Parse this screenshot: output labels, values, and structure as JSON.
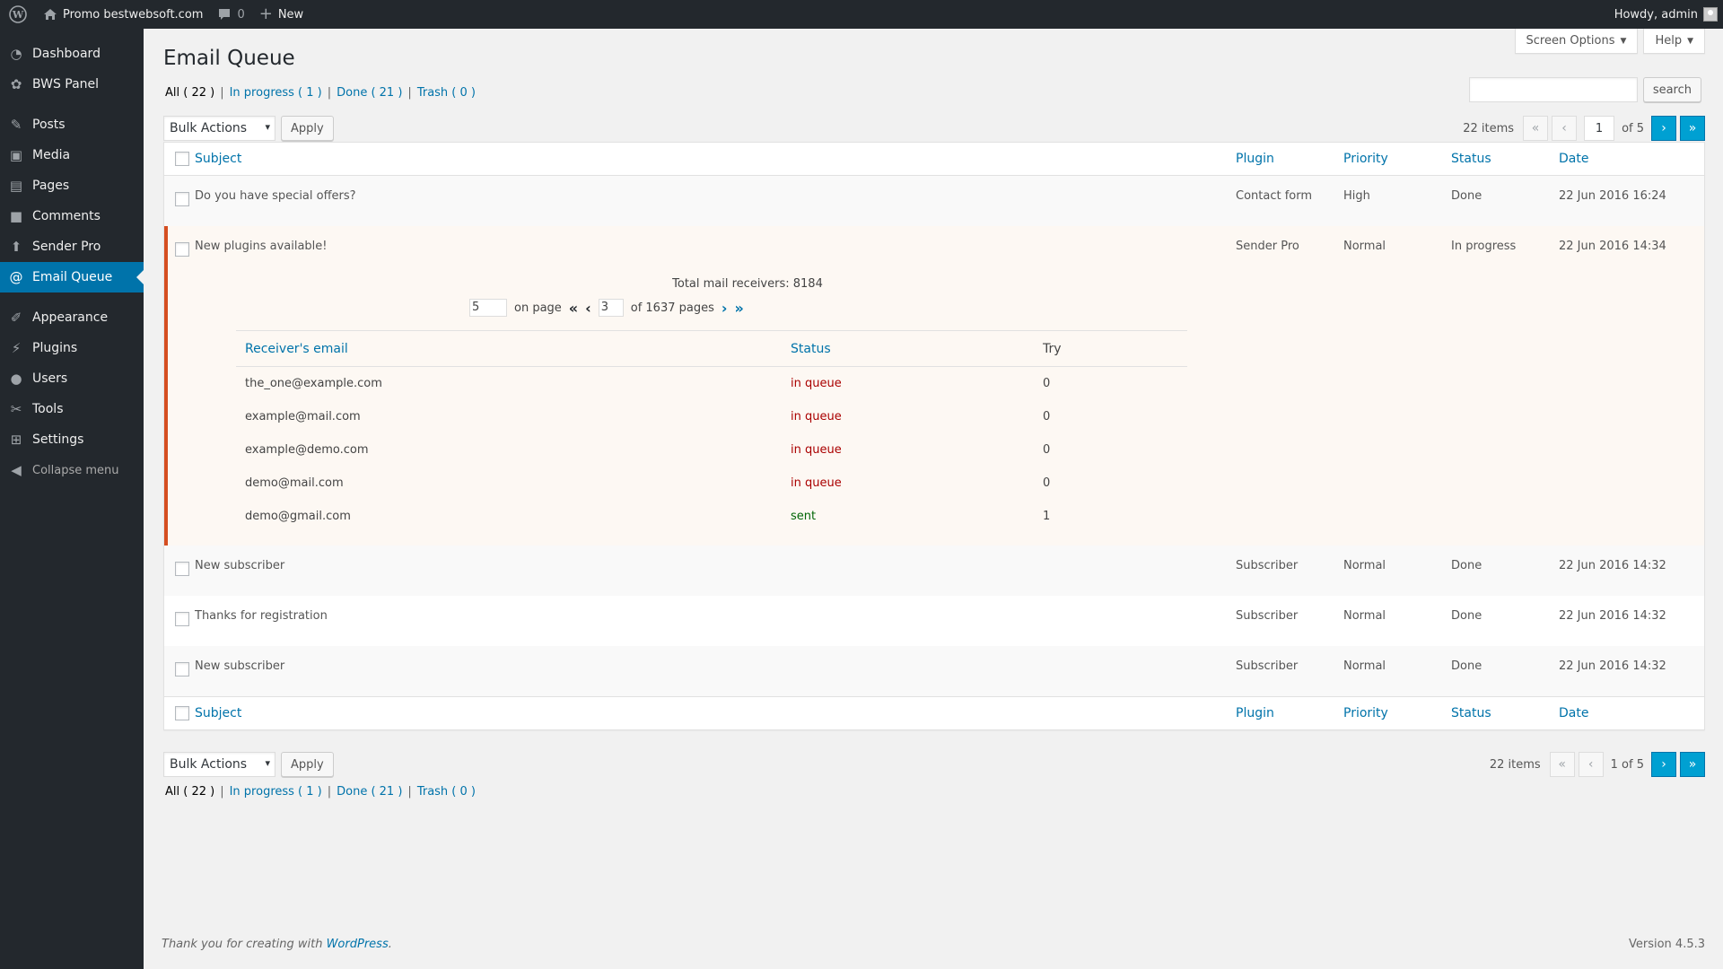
{
  "adminbar": {
    "site_name": "Promo bestwebsoft.com",
    "comments_count": "0",
    "new_label": "New",
    "howdy": "Howdy, admin"
  },
  "sidebar": {
    "items": [
      {
        "label": "Dashboard",
        "icon": "dashboard-icon"
      },
      {
        "label": "BWS Panel",
        "icon": "bws-panel-icon"
      },
      {
        "label": "Posts",
        "icon": "pin-icon"
      },
      {
        "label": "Media",
        "icon": "media-icon"
      },
      {
        "label": "Pages",
        "icon": "pages-icon"
      },
      {
        "label": "Comments",
        "icon": "comment-icon"
      },
      {
        "label": "Sender Pro",
        "icon": "sender-icon"
      },
      {
        "label": "Email Queue",
        "icon": "at-icon"
      },
      {
        "label": "Appearance",
        "icon": "brush-icon"
      },
      {
        "label": "Plugins",
        "icon": "plug-icon"
      },
      {
        "label": "Users",
        "icon": "user-icon"
      },
      {
        "label": "Tools",
        "icon": "wrench-icon"
      },
      {
        "label": "Settings",
        "icon": "settings-icon"
      }
    ],
    "collapse_label": "Collapse menu"
  },
  "screen_options_label": "Screen Options",
  "help_label": "Help",
  "page_title": "Email Queue",
  "filters": {
    "all": "All ( 22 )",
    "in_progress": "In progress ( 1 )",
    "done": "Done ( 21 )",
    "trash": "Trash ( 0 )",
    "sep": "|"
  },
  "search": {
    "button": "search",
    "value": ""
  },
  "bulk": {
    "selected": "Bulk Actions",
    "apply": "Apply"
  },
  "pagination_top": {
    "items": "22 items",
    "current": "1",
    "of": "of 5",
    "first": "«",
    "prev": "‹",
    "next": "›",
    "last": "»"
  },
  "pagination_bottom": {
    "items": "22 items",
    "text": "1 of 5"
  },
  "columns": {
    "subject": "Subject",
    "plugin": "Plugin",
    "priority": "Priority",
    "status": "Status",
    "date": "Date"
  },
  "rows": [
    {
      "subject": "Do you have special offers?",
      "plugin": "Contact form",
      "priority": "High",
      "status": "Done",
      "date": "22 Jun 2016 16:24"
    },
    {
      "subject": "New plugins available!",
      "plugin": "Sender Pro",
      "priority": "Normal",
      "status": "In progress",
      "date": "22 Jun 2016 14:34"
    },
    {
      "subject": "New subscriber",
      "plugin": "Subscriber",
      "priority": "Normal",
      "status": "Done",
      "date": "22 Jun 2016 14:32"
    },
    {
      "subject": "Thanks for registration",
      "plugin": "Subscriber",
      "priority": "Normal",
      "status": "Done",
      "date": "22 Jun 2016 14:32"
    },
    {
      "subject": "New subscriber",
      "plugin": "Subscriber",
      "priority": "Normal",
      "status": "Done",
      "date": "22 Jun 2016 14:32"
    }
  ],
  "detail": {
    "total": "Total mail receivers: 8184",
    "per_page": "5",
    "on_page": "on page",
    "page": "3",
    "of_pages": "of 1637 pages",
    "first": "«",
    "prev": "‹",
    "next": "›",
    "last": "»",
    "headers": {
      "email": "Receiver's email",
      "status": "Status",
      "try": "Try"
    },
    "receivers": [
      {
        "email": "the_one@example.com",
        "status": "in queue",
        "try": "0"
      },
      {
        "email": "example@mail.com",
        "status": "in queue",
        "try": "0"
      },
      {
        "email": "example@demo.com",
        "status": "in queue",
        "try": "0"
      },
      {
        "email": "demo@mail.com",
        "status": "in queue",
        "try": "0"
      },
      {
        "email": "demo@gmail.com",
        "status": "sent",
        "try": "1"
      }
    ]
  },
  "footer": {
    "thanks": "Thank you for creating with ",
    "wp_link": "WordPress",
    "period": ".",
    "version": "Version 4.5.3"
  },
  "colors": {
    "adminbar": "#23282d",
    "accent": "#0073aa",
    "done": "#006505",
    "queue": "#aa0000",
    "highlight_border": "#d54e21"
  }
}
